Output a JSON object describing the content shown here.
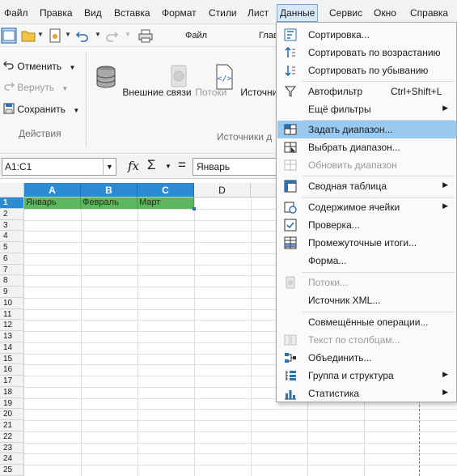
{
  "menubar": {
    "items": [
      {
        "label": "Файл"
      },
      {
        "label": "Правка"
      },
      {
        "label": "Вид"
      },
      {
        "label": "Вставка"
      },
      {
        "label": "Формат"
      },
      {
        "label": "Стили"
      },
      {
        "label": "Лист"
      },
      {
        "label": "Данные"
      },
      {
        "label": "Сервис"
      },
      {
        "label": "Окно"
      },
      {
        "label": "Справка"
      }
    ],
    "active": "Данные"
  },
  "toolbar": {
    "tab_file": "Файл",
    "tab_home": "Главная"
  },
  "ribbon": {
    "undo_label": "Отменить",
    "redo_label": "Вернуть",
    "save_label": "Сохранить",
    "group_actions_label": "Действия",
    "external_links_label": "Внешние связи",
    "streams_label": "Потоки",
    "xml_source_label": "Источник XML",
    "group_sources_label": "Источники д"
  },
  "formula_bar": {
    "name_box_value": "A1:C1",
    "formula_value": "Январь"
  },
  "sheet": {
    "columns": [
      "A",
      "B",
      "C",
      "D"
    ],
    "rows": [
      "1",
      "2",
      "3",
      "4",
      "5",
      "6",
      "7",
      "8",
      "9",
      "10",
      "11",
      "12",
      "13",
      "14",
      "15",
      "16",
      "17",
      "18",
      "19",
      "20",
      "21",
      "22",
      "23",
      "24",
      "25"
    ],
    "row1_cells": [
      "Январь",
      "Февраль",
      "Март"
    ],
    "selection_color": "#5cb85c",
    "header_selected_color": "#2d8bd4"
  },
  "data_menu": {
    "items": [
      {
        "label": "Сортировка...",
        "icon": "sort-icon"
      },
      {
        "label": "Сортировать по возрастанию",
        "icon": "sort-ascending-icon"
      },
      {
        "label": "Сортировать по убыванию",
        "icon": "sort-descending-icon"
      },
      {
        "label": "Автофильтр",
        "shortcut": "Ctrl+Shift+L",
        "icon": "autofilter-icon"
      },
      {
        "label": "Ещё фильтры"
      },
      {
        "label": "Задать диапазон...",
        "icon": "define-range-icon"
      },
      {
        "label": "Выбрать диапазон...",
        "icon": "select-range-icon"
      },
      {
        "label": "Обновить диапазон",
        "icon": "refresh-range-icon"
      },
      {
        "label": "Сводная таблица",
        "icon": "pivot-table-icon"
      },
      {
        "label": "Содержимое ячейки",
        "icon": "cell-contents-icon"
      },
      {
        "label": "Проверка...",
        "icon": "validation-icon"
      },
      {
        "label": "Промежуточные итоги...",
        "icon": "subtotals-icon"
      },
      {
        "label": "Форма..."
      },
      {
        "label": "Потоки...",
        "icon": "streams-icon"
      },
      {
        "label": "Источник XML..."
      },
      {
        "label": "Совмещённые операции..."
      },
      {
        "label": "Текст по столбцам...",
        "icon": "text-to-columns-icon"
      },
      {
        "label": "Объединить...",
        "icon": "consolidate-icon"
      },
      {
        "label": "Группа и структура",
        "icon": "group-outline-icon"
      },
      {
        "label": "Статистика",
        "icon": "statistics-icon"
      }
    ],
    "highlighted": "Задать диапазон...",
    "highlight_color": "#99c9ef"
  }
}
